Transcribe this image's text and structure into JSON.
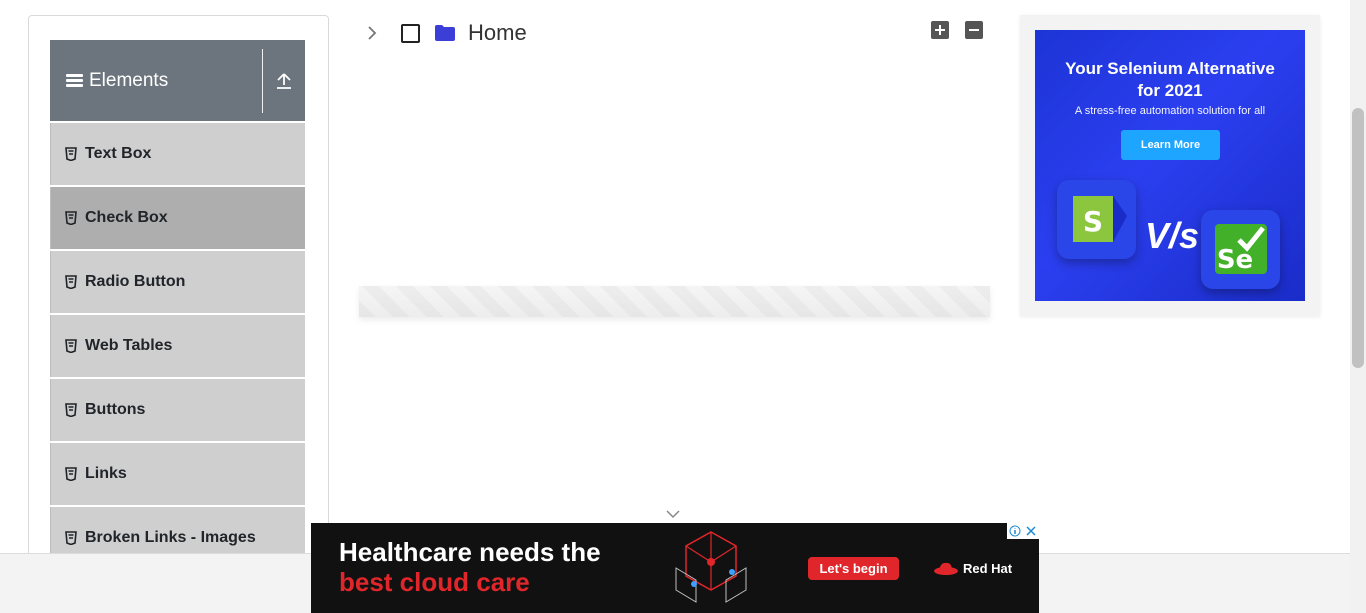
{
  "sidebar": {
    "group_title": "Elements",
    "items": [
      {
        "label": "Text Box"
      },
      {
        "label": "Check Box",
        "active": true
      },
      {
        "label": "Radio Button"
      },
      {
        "label": "Web Tables"
      },
      {
        "label": "Buttons"
      },
      {
        "label": "Links"
      },
      {
        "label": "Broken Links - Images"
      }
    ]
  },
  "tree": {
    "root_label": "Home",
    "expand_all_icon": "plus-square-icon",
    "collapse_all_icon": "minus-square-icon"
  },
  "ad_right": {
    "headline_line1": "Your Selenium Alternative",
    "headline_line2": "for 2021",
    "subtitle": "A stress-free automation solution for all",
    "cta": "Learn More",
    "versus": "V/s"
  },
  "ad_bottom": {
    "line1": "Healthcare needs the",
    "line2": "best cloud care",
    "cta": "Let's begin",
    "brand": "Red Hat"
  },
  "colors": {
    "sidebar_header": "#6c757d",
    "menu_item": "#cfcfcf",
    "menu_item_active": "#aeaeae",
    "folder": "#3b3fd8",
    "ad_right_bg": "#1d34d6",
    "redhat_red": "#e0262a"
  }
}
